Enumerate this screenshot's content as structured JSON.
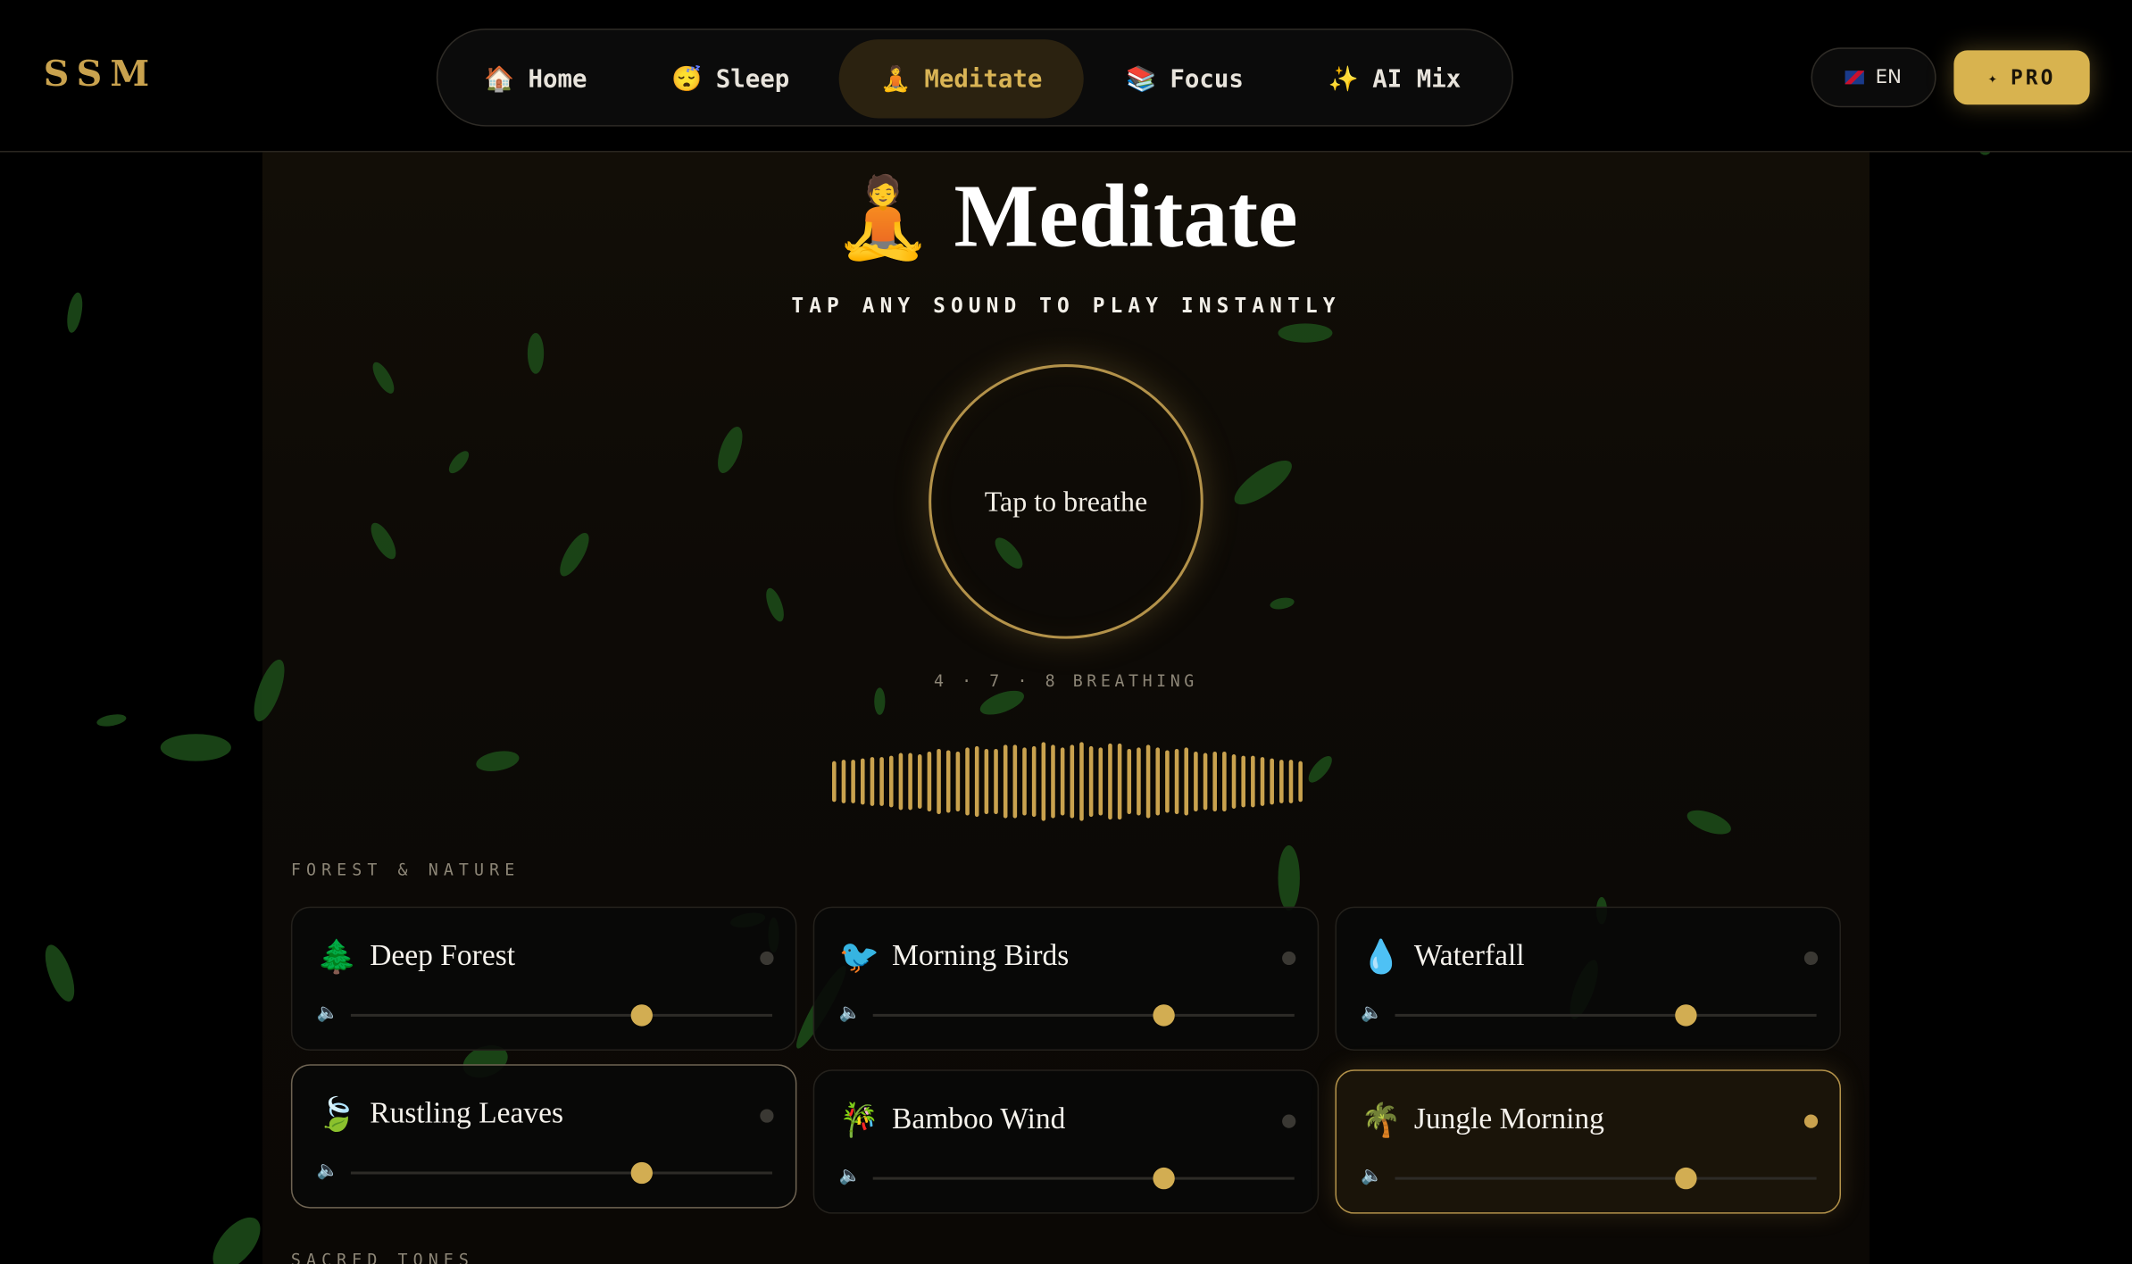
{
  "header": {
    "logo": "SSM",
    "nav": [
      {
        "icon": "🏠",
        "icon_name": "home-icon",
        "label": "Home",
        "active": false
      },
      {
        "icon": "😴",
        "icon_name": "sleep-icon",
        "label": "Sleep",
        "active": false
      },
      {
        "icon": "🧘",
        "icon_name": "meditate-icon",
        "label": "Meditate",
        "active": true
      },
      {
        "icon": "📚",
        "icon_name": "books-icon",
        "label": "Focus",
        "active": false
      },
      {
        "icon": "✨",
        "icon_name": "sparkles-icon",
        "label": "AI Mix",
        "active": false
      }
    ],
    "lang_label": "EN",
    "pro_label": "PRO",
    "pro_icon": "✦"
  },
  "page": {
    "title_icon": "🧘",
    "title": "Meditate",
    "subtitle": "TAP ANY SOUND TO PLAY INSTANTLY",
    "breath_label": "Tap to breathe",
    "breath_pattern": "4 · 7 · 8 BREATHING"
  },
  "colors": {
    "accent": "#c9a24e",
    "background": "#000000",
    "leaf": "#1d4d1a"
  },
  "sections": [
    {
      "label": "FOREST & NATURE",
      "sounds": [
        {
          "icon": "🌲",
          "icon_name": "tree-icon",
          "name": "Deep Forest",
          "volume": 0.69,
          "playing": false
        },
        {
          "icon": "🐦",
          "icon_name": "bird-icon",
          "name": "Morning Birds",
          "volume": 0.69,
          "playing": false
        },
        {
          "icon": "💧",
          "icon_name": "droplet-icon",
          "name": "Waterfall",
          "volume": 0.69,
          "playing": false
        },
        {
          "icon": "🍃",
          "icon_name": "leaves-icon",
          "name": "Rustling Leaves",
          "volume": 0.69,
          "playing": false
        },
        {
          "icon": "🎋",
          "icon_name": "bamboo-icon",
          "name": "Bamboo Wind",
          "volume": 0.69,
          "playing": false
        },
        {
          "icon": "🌴",
          "icon_name": "palm-icon",
          "name": "Jungle Morning",
          "volume": 0.69,
          "playing": true
        }
      ]
    },
    {
      "label": "SACRED TONES",
      "sounds": []
    }
  ],
  "volume_icon": "🔈"
}
